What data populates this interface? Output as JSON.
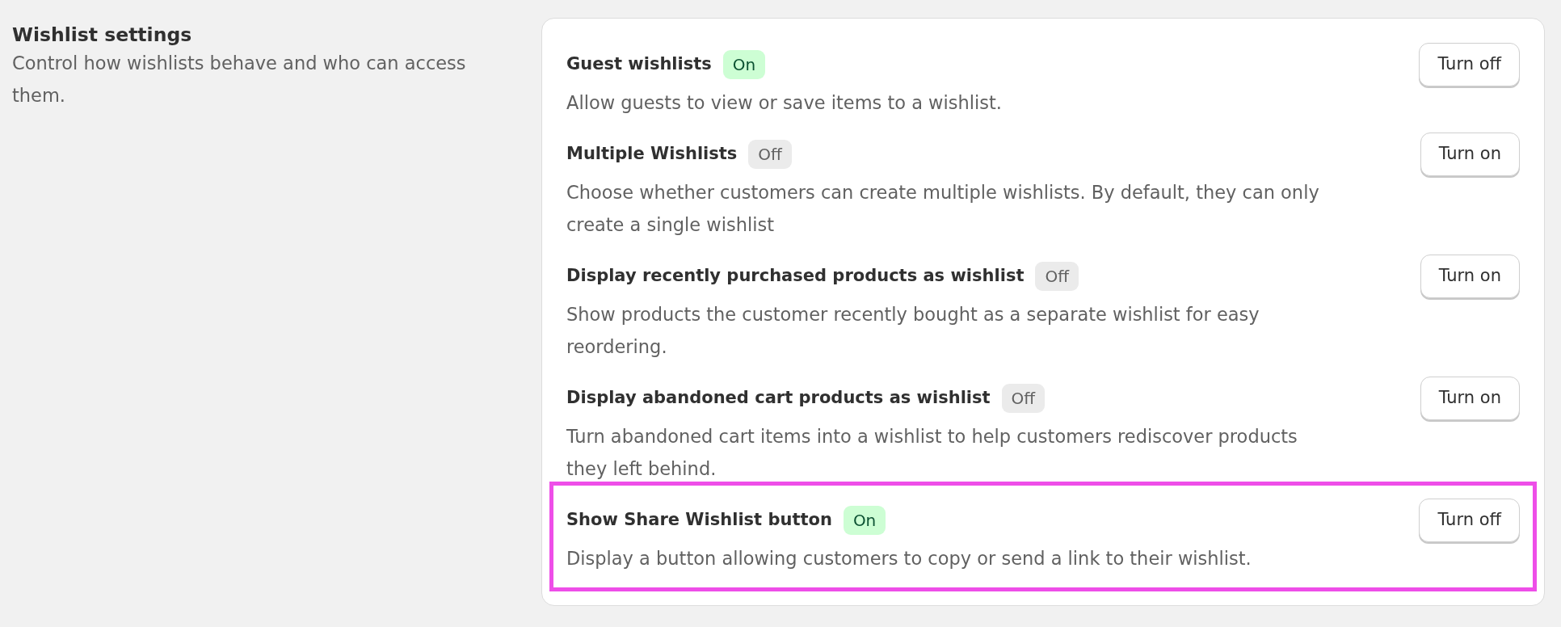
{
  "section": {
    "title": "Wishlist settings",
    "description": "Control how wishlists behave and who can access them."
  },
  "settings": [
    {
      "title": "Guest wishlists",
      "on": true,
      "status": "On",
      "description": "Allow guests to view or save items to a wishlist.",
      "button": "Turn off",
      "highlighted": false
    },
    {
      "title": "Multiple Wishlists",
      "on": false,
      "status": "Off",
      "description": "Choose whether customers can create multiple wishlists. By default, they can only create a single wishlist",
      "button": "Turn on",
      "highlighted": false
    },
    {
      "title": "Display recently purchased products as wishlist",
      "on": false,
      "status": "Off",
      "description": "Show products the customer recently bought as a separate wishlist for easy reordering.",
      "button": "Turn on",
      "highlighted": false
    },
    {
      "title": "Display abandoned cart products as wishlist",
      "on": false,
      "status": "Off",
      "description": "Turn abandoned cart items into a wishlist to help customers rediscover products they left behind.",
      "button": "Turn on",
      "highlighted": false
    },
    {
      "title": "Show Share Wishlist button",
      "on": true,
      "status": "On",
      "description": "Display a button allowing customers to copy or send a link to their wishlist.",
      "button": "Turn off",
      "highlighted": true
    }
  ]
}
